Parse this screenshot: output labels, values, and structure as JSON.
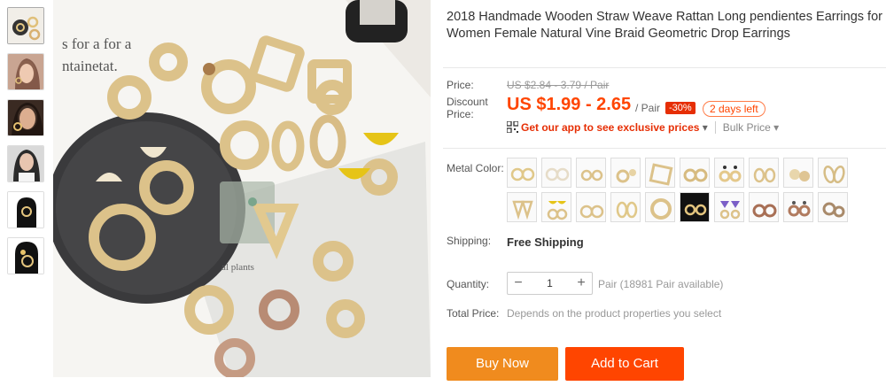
{
  "product": {
    "title": "2018 Handmade Wooden Straw Weave Rattan Long pendientes Earrings for Women Female Natural Vine Braid Geometric Drop Earrings"
  },
  "price": {
    "price_label": "Price:",
    "original": "US $2.84 - 3.79 / Pair",
    "discount_label": "Discount Price:",
    "discount_value": "US $1.99 - 2.65",
    "unit": "/ Pair",
    "off_badge": "-30%",
    "days_left": "2 days left"
  },
  "promo": {
    "app_link": "Get our app to see exclusive prices",
    "app_caret": "▾",
    "bulk_link": "Bulk Price",
    "bulk_caret": "▾"
  },
  "options": {
    "metal_color_label": "Metal Color:",
    "swatch_count": 20
  },
  "shipping": {
    "label": "Shipping:",
    "value": "Free Shipping"
  },
  "quantity": {
    "label": "Quantity:",
    "minus": "−",
    "value": "1",
    "plus": "+",
    "available": "Pair (18981 Pair available)"
  },
  "total": {
    "label": "Total Price:",
    "value": "Depends on the product properties you select"
  },
  "actions": {
    "buy_now": "Buy Now",
    "add_to_cart": "Add to Cart"
  },
  "colors": {
    "accent": "#ff4500",
    "buy_now_bg": "#f08b1e",
    "badge_red": "#e62e04"
  },
  "icons": [
    "qr-code-icon",
    "caret-down-icon"
  ]
}
